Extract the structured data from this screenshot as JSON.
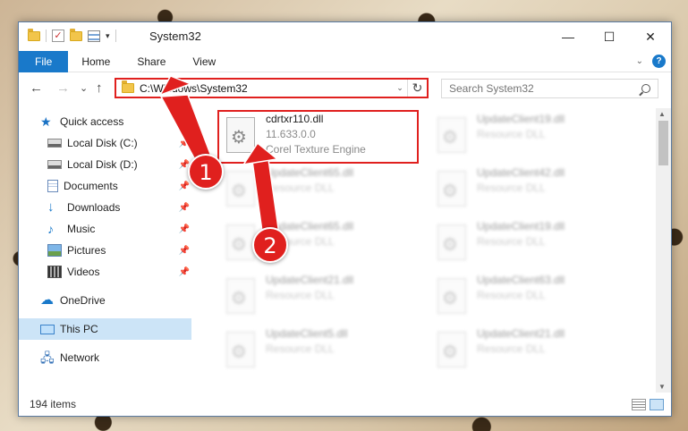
{
  "window": {
    "title": "System32",
    "minimize": "—",
    "maximize": "☐",
    "close": "✕"
  },
  "ribbon": {
    "tabs": [
      "File",
      "Home",
      "Share",
      "View"
    ],
    "collapse": "⌄",
    "help": "?"
  },
  "navigation": {
    "back": "←",
    "forward": "→",
    "recent": "⌄",
    "up": "↑",
    "address": "C:\\Windows\\System32",
    "address_dropdown": "⌄",
    "refresh": "↻",
    "search_placeholder": "Search System32"
  },
  "sidebar": {
    "items": [
      {
        "label": "Quick access",
        "icon": "star-icon",
        "pinned": false
      },
      {
        "label": "Local Disk (C:)",
        "icon": "drive-icon",
        "pinned": true
      },
      {
        "label": "Local Disk (D:)",
        "icon": "drive-icon",
        "pinned": true
      },
      {
        "label": "Documents",
        "icon": "documents-icon",
        "pinned": true
      },
      {
        "label": "Downloads",
        "icon": "downloads-icon",
        "pinned": true
      },
      {
        "label": "Music",
        "icon": "music-icon",
        "pinned": true
      },
      {
        "label": "Pictures",
        "icon": "pictures-icon",
        "pinned": true
      },
      {
        "label": "Videos",
        "icon": "videos-icon",
        "pinned": true
      },
      {
        "label": "OneDrive",
        "icon": "onedrive-icon",
        "pinned": false
      },
      {
        "label": "This PC",
        "icon": "this-pc-icon",
        "pinned": false
      },
      {
        "label": "Network",
        "icon": "network-icon",
        "pinned": false
      }
    ],
    "pin_glyph": "📌"
  },
  "files": [
    {
      "name": "cdrtxr110.dll",
      "line2": "11.633.0.0",
      "line3": "Corel Texture Engine",
      "blurred": false
    },
    {
      "name": "UpdateClient19.dll",
      "line2": "Resource DLL",
      "blurred": true
    },
    {
      "name": "UpdateClient65.dll",
      "line2": "Resource DLL",
      "blurred": true
    },
    {
      "name": "UpdateClient42.dll",
      "line2": "Resource DLL",
      "blurred": true
    },
    {
      "name": "UpdateClient65.dll",
      "line2": "Resource DLL",
      "blurred": true
    },
    {
      "name": "UpdateClient19.dll",
      "line2": "Resource DLL",
      "blurred": true
    },
    {
      "name": "UpdateClient21.dll",
      "line2": "Resource DLL",
      "blurred": true
    },
    {
      "name": "UpdateClient63.dll",
      "line2": "Resource DLL",
      "blurred": true
    },
    {
      "name": "UpdateClient5.dll",
      "line2": "Resource DLL",
      "blurred": true
    },
    {
      "name": "UpdateClient21.dll",
      "line2": "Resource DLL",
      "blurred": true
    }
  ],
  "status": {
    "item_count": "194 items"
  },
  "annotations": {
    "step1": "1",
    "step2": "2",
    "color": "#e0201e"
  }
}
